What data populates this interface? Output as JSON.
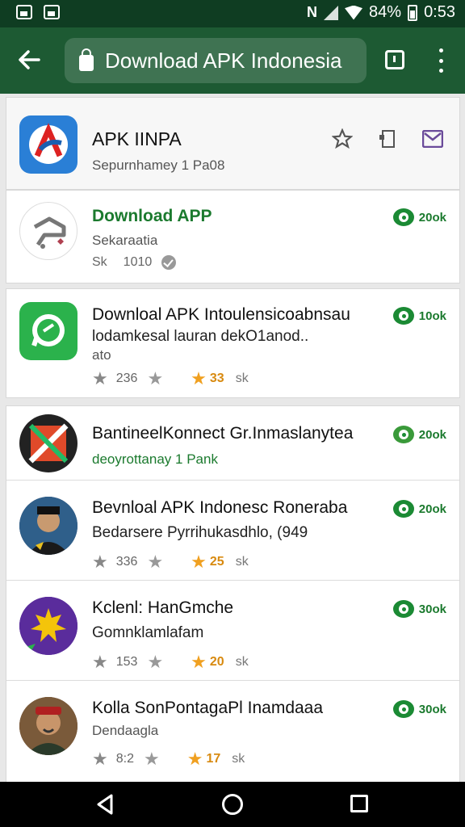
{
  "status_bar": {
    "battery": "84%",
    "time": "0:53"
  },
  "app_bar": {
    "url_title": "Download APK Indonesia"
  },
  "header_card": {
    "title": "APK IINPA",
    "subtitle": "Sepurnhamey 1 Pa08"
  },
  "rows": [
    {
      "title": "Download APP",
      "subtitle": "Sekaraatia",
      "count": "20ok",
      "meta_a": "Sk",
      "meta_b": "1010"
    },
    {
      "title": "Downloal APK Intoulensicoabnsau",
      "line2": "lodamkesal lauran dekO1anod..",
      "line3": "ato",
      "count": "10ok",
      "rating_g": "236",
      "rating": "33",
      "downloads": "sk"
    },
    {
      "title": "BantineelKonnect Gr.Inmaslanytea",
      "subtitle": "deoyrottanay 1 Pank",
      "count": "20ok"
    },
    {
      "title": "Bevnloal APK Indonesc Roneraba",
      "subtitle": "Bedarsere Pyrrihukasdhlo, (949",
      "count": "20ok",
      "rating_g": "336",
      "rating": "25",
      "downloads": "sk"
    },
    {
      "title": "Kclenl: HanGmche",
      "subtitle": "Gomnklamlafam",
      "count": "30ok",
      "rating_g": "153",
      "rating": "20",
      "downloads": "sk"
    },
    {
      "title": "Kolla SonPontagaPl Inamdaaa",
      "subtitle": "Dendaagla",
      "count": "30ok",
      "rating_g": "8:2",
      "rating": "17",
      "downloads": "sk"
    }
  ]
}
